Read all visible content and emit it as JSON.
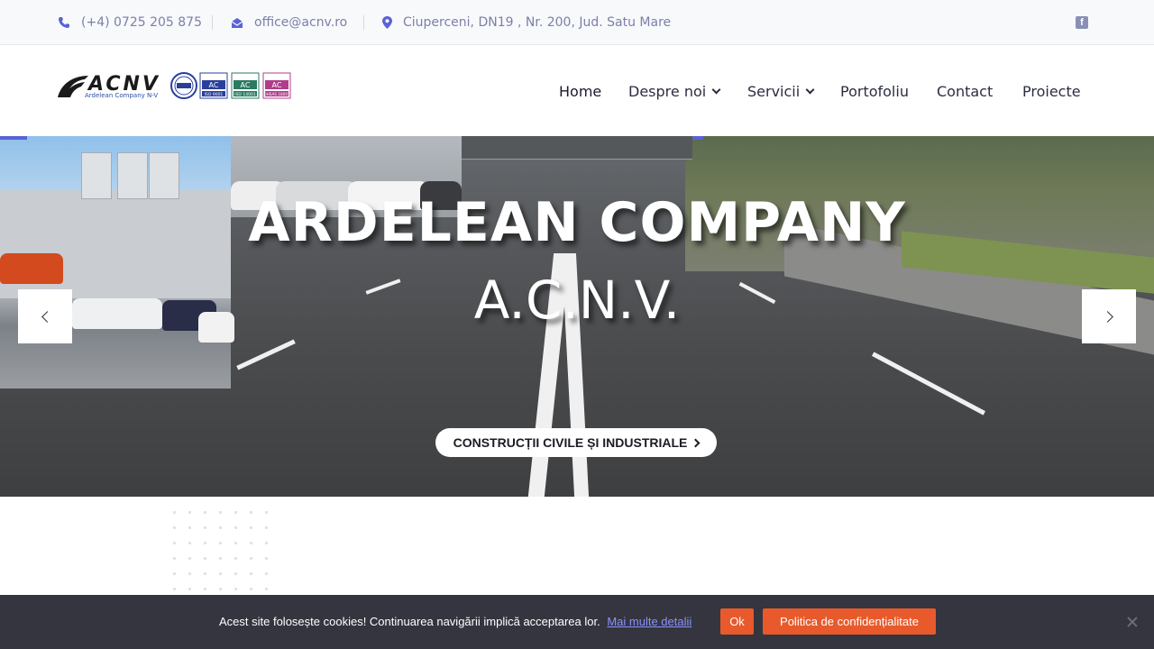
{
  "topbar": {
    "phone": "(+4) 0725 205 875",
    "email": "office@acnv.ro",
    "address": "Ciuperceni, DN19 , Nr. 200, Jud. Satu Mare",
    "social_icon": "facebook-icon"
  },
  "logo": {
    "brand": "ACNV",
    "tagline": "Ardelean Company N-V",
    "certs": [
      "ISO 9001",
      "ISO 14001",
      "OHSAS 18001"
    ],
    "cert_mark": "AC"
  },
  "nav": {
    "items": [
      {
        "label": "Home",
        "active": true,
        "dropdown": false
      },
      {
        "label": "Despre noi",
        "active": false,
        "dropdown": true
      },
      {
        "label": "Servicii",
        "active": false,
        "dropdown": true
      },
      {
        "label": "Portofoliu",
        "active": false,
        "dropdown": false
      },
      {
        "label": "Contact",
        "active": false,
        "dropdown": false
      },
      {
        "label": "Proiecte",
        "active": false,
        "dropdown": false
      }
    ]
  },
  "hero": {
    "title": "ARDELEAN COMPANY",
    "subtitle": "A.C.N.V.",
    "cta_label": "CONSTRUCȚII CIVILE ȘI INDUSTRIALE"
  },
  "cookie": {
    "message": "Acest site folosește cookies! Continuarea navigării implică acceptarea lor.",
    "link_label": "Mai multe detalii",
    "ok_label": "Ok",
    "policy_label": "Politica de confidențialitate"
  },
  "colors": {
    "accent": "#5a62d6",
    "cookie_button": "#e85a2b",
    "cookie_bar": "#34353f",
    "topbar_text": "#7b80a8"
  }
}
